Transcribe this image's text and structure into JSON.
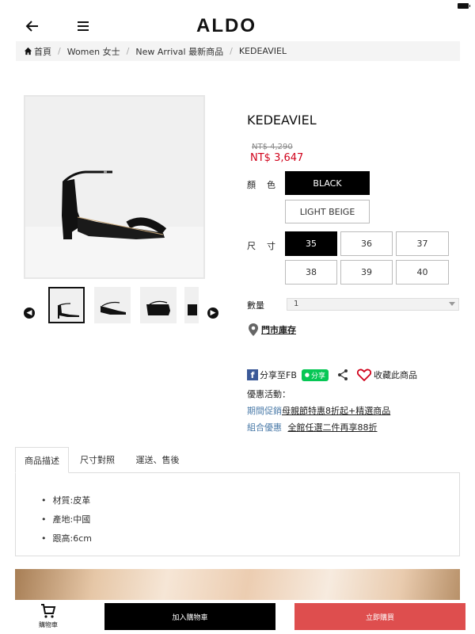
{
  "header": {
    "logo": "ALDO",
    "back_icon": "arrow-left-icon",
    "menu_icon": "hamburger-menu-icon"
  },
  "breadcrumb": {
    "items": [
      "首頁",
      "Women 女士",
      "New Arrival 最新商品",
      "KEDEAVIEL"
    ]
  },
  "product": {
    "title": "KEDEAVIEL",
    "original_price": "NT$ 4,290",
    "sale_price": "NT$ 3,647",
    "color_label": "顏色",
    "colors": [
      "BLACK",
      "LIGHT BEIGE"
    ],
    "selected_color": "BLACK",
    "size_label": "尺寸",
    "sizes": [
      "35",
      "36",
      "37",
      "38",
      "39",
      "40"
    ],
    "selected_size": "35",
    "qty_label": "數量",
    "qty_value": "1",
    "store_stock": "門市庫存"
  },
  "share": {
    "fb": "分享至FB",
    "line": "分享",
    "favorite": "收藏此商品"
  },
  "promotions": {
    "title": "優惠活動：",
    "items": [
      {
        "tag": "期間促銷",
        "text": "母親節特惠8折起+精選商品"
      },
      {
        "tag": "組合優惠",
        "text": "全館任選二件再享88折"
      }
    ]
  },
  "tabs": [
    "商品描述",
    "尺寸對照",
    "運送、售後"
  ],
  "specs": [
    "材質:皮革",
    "產地:中國",
    "跟高:6cm"
  ],
  "bottom_bar": {
    "cart": "購物車",
    "add_to_cart": "加入購物車",
    "buy_now": "立即購買"
  },
  "colors": {
    "sale_red": "#d0021b",
    "buy_button": "#de4e4e",
    "promo_tag": "#4a7aa8"
  }
}
